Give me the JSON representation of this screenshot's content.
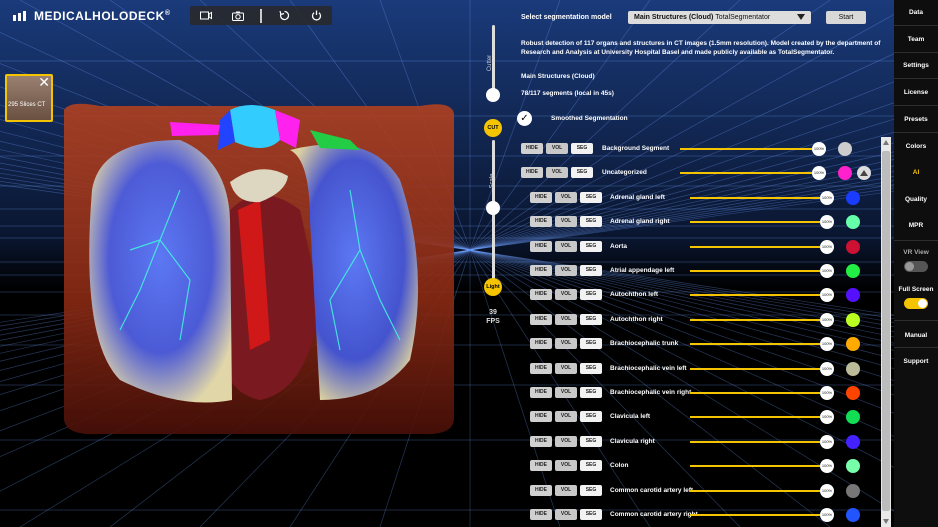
{
  "app": {
    "logo_text": "MEDICALHOLODECK",
    "logo_mark": "®"
  },
  "toolbar": {
    "icons": [
      "video-camera-icon",
      "camera-icon",
      "reset-icon",
      "power-icon"
    ]
  },
  "thumbnail": {
    "label": "295 Slices CT",
    "close": "✕"
  },
  "sliders": {
    "cutter_label": "Cutter",
    "cut_label": "CUT",
    "scale_label": "Scale",
    "light_label": "Light",
    "fps_value": "39",
    "fps_unit": "FPS"
  },
  "segmentation": {
    "title": "Select segmentation model",
    "model_name": "Main Structures (Cloud)",
    "model_sub": "TotalSegmentator",
    "start_label": "Start",
    "description": "Robust detection of 117 organs and structures in CT images (1.5mm resolution). Model created by the department of Research and Analysis at University Hospital Basel and made publicly available as TotalSegmentator.",
    "current_model": "Main Structures (Cloud)",
    "segments_info": "78/117 segments (local in 45s)",
    "smoothed_label": "Smoothed Segmentation",
    "hide_label": "HIDE",
    "vol_label": "VOL",
    "seg_label": "SEG",
    "opacity_label": "100%",
    "rows": [
      {
        "name": "Background Segment",
        "color": "#cccccc",
        "level": 0
      },
      {
        "name": "Uncategorized",
        "color": "#ff22cc",
        "level": 0
      },
      {
        "name": "Adrenal gland left",
        "color": "#1a3cff",
        "level": 1
      },
      {
        "name": "Adrenal gland right",
        "color": "#66ffaa",
        "level": 1
      },
      {
        "name": "Aorta",
        "color": "#cc1133",
        "level": 1
      },
      {
        "name": "Atrial appendage left",
        "color": "#22ee44",
        "level": 1
      },
      {
        "name": "Autochthon left",
        "color": "#5511ff",
        "level": 1
      },
      {
        "name": "Autochthon right",
        "color": "#bbff22",
        "level": 1
      },
      {
        "name": "Brachiocephalic trunk",
        "color": "#ffaa00",
        "level": 1
      },
      {
        "name": "Brachiocephalic vein left",
        "color": "#bbbb99",
        "level": 1
      },
      {
        "name": "Brachiocephalic vein right",
        "color": "#ff4400",
        "level": 1
      },
      {
        "name": "Clavicula left",
        "color": "#11dd55",
        "level": 1
      },
      {
        "name": "Clavicula right",
        "color": "#4422ff",
        "level": 1
      },
      {
        "name": "Colon",
        "color": "#77ffaa",
        "level": 1
      },
      {
        "name": "Common carotid artery left",
        "color": "#777777",
        "level": 1
      },
      {
        "name": "Common carotid artery right",
        "color": "#2255ff",
        "level": 1
      }
    ]
  },
  "sidebar": {
    "items": [
      "Data",
      "Team",
      "Settings",
      "License",
      "Presets",
      "Colors",
      "AI",
      "Quality",
      "MPR"
    ],
    "active": "AI",
    "vr_view_label": "VR View",
    "fullscreen_label": "Full Screen",
    "bottom_items": [
      "Manual",
      "Support"
    ]
  }
}
